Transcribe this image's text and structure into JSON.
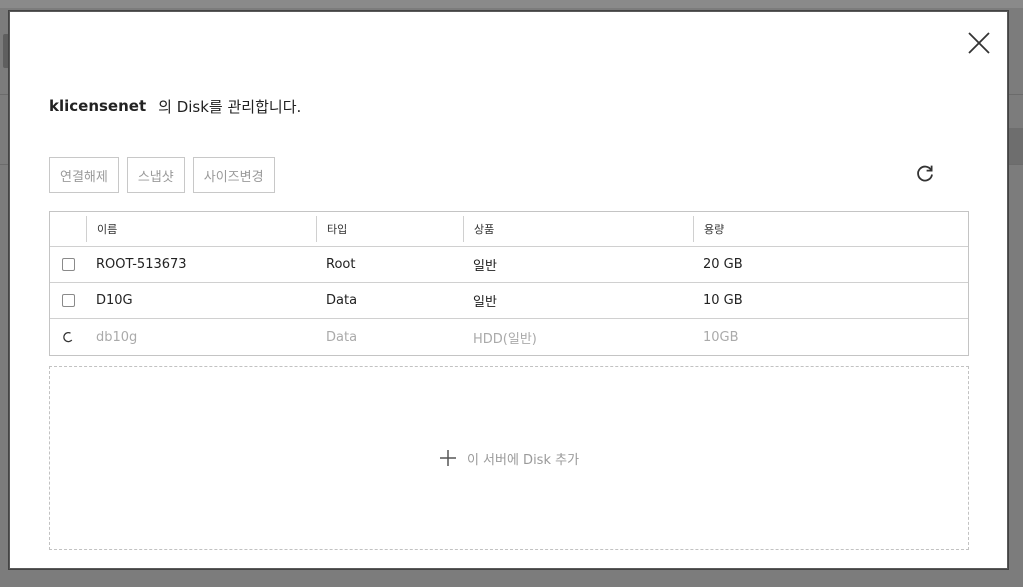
{
  "modal": {
    "server_name": "klicensenet",
    "title_suffix": "의 Disk를 관리합니다.",
    "toolbar": {
      "detach_label": "연결해제",
      "snapshot_label": "스냅샷",
      "resize_label": "사이즈변경"
    },
    "table": {
      "headers": {
        "name": "이름",
        "type": "타입",
        "product": "상품",
        "capacity": "용량"
      },
      "rows": [
        {
          "name": "ROOT-513673",
          "type": "Root",
          "product": "일반",
          "capacity": "20 GB"
        },
        {
          "name": "D10G",
          "type": "Data",
          "product": "일반",
          "capacity": "10 GB"
        },
        {
          "name": "db10g",
          "type": "Data",
          "product": "HDD(일반)",
          "capacity": "10GB"
        }
      ]
    },
    "add_disk_label": "이 서버에 Disk 추가",
    "icons": {
      "close": "close-icon",
      "refresh": "refresh-icon",
      "plus": "plus-icon",
      "spinner": "loading-spinner-icon"
    }
  },
  "colors": {
    "overlay": "#7a7a7a",
    "muted_text": "#aaaaaa",
    "border": "#c4c4c4"
  }
}
